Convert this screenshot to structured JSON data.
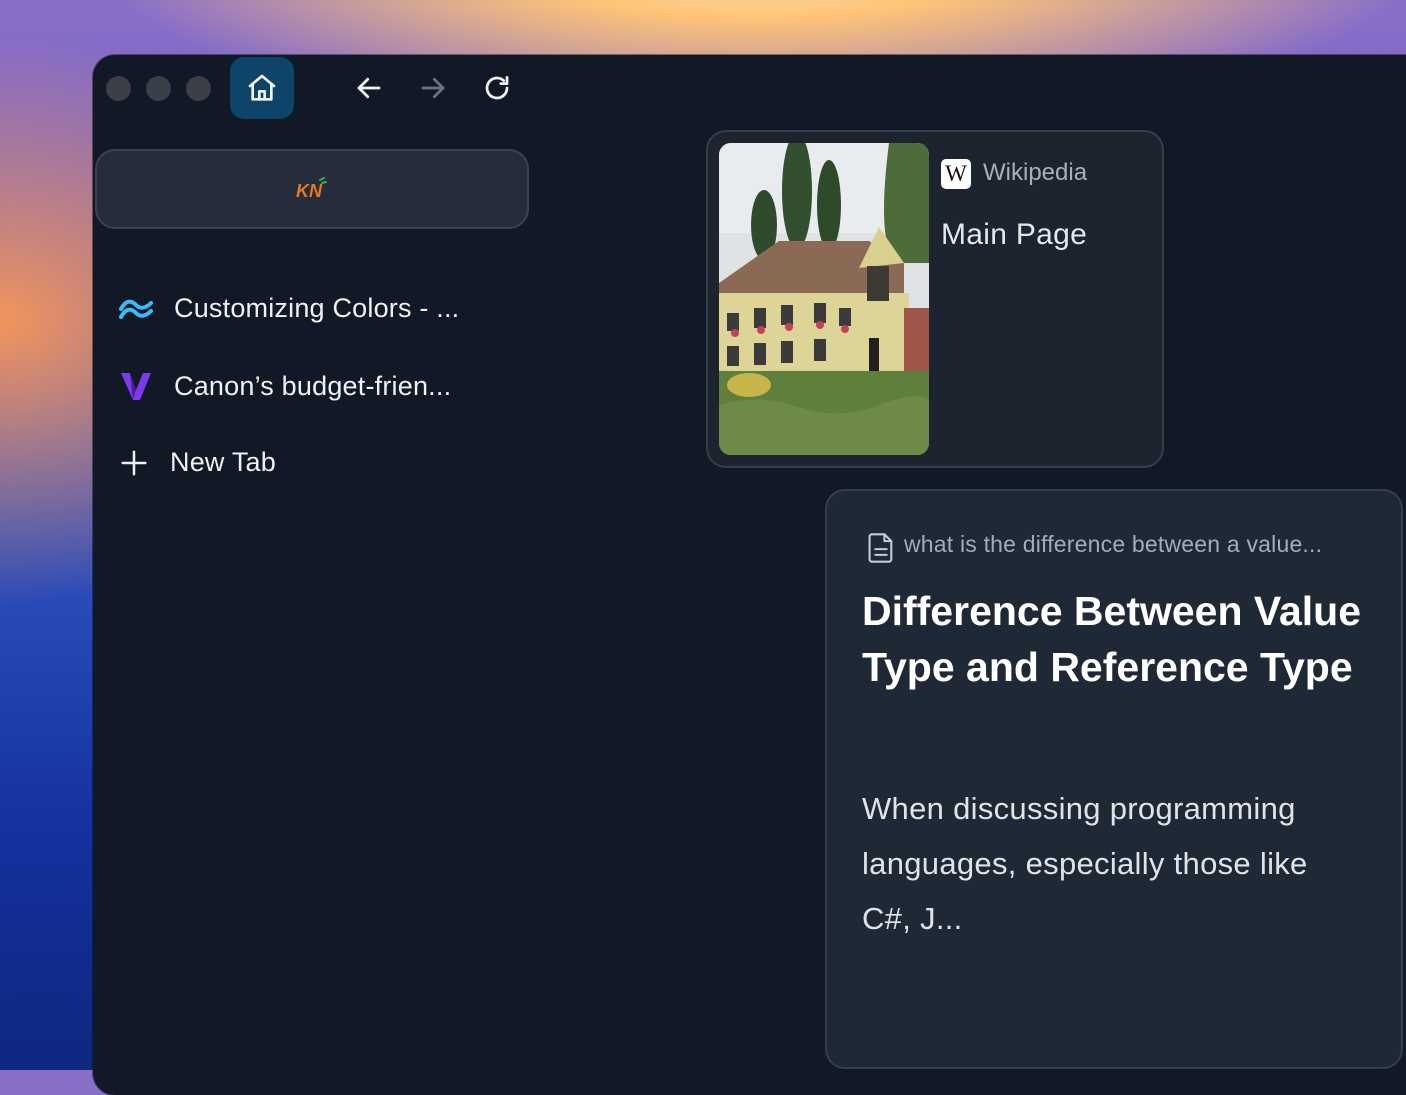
{
  "window": {
    "controls": [
      "close",
      "minimize",
      "zoom"
    ],
    "toolbar": {
      "home_icon": "home-icon",
      "back_icon": "arrow-left-icon",
      "forward_icon": "arrow-right-icon",
      "reload_icon": "reload-icon"
    }
  },
  "urlbar": {
    "logo_text": "KN"
  },
  "tabs": [
    {
      "icon": "tailwind-icon",
      "label": "Customizing Colors - ..."
    },
    {
      "icon": "v-logo-icon",
      "label": "Canon’s budget-frien..."
    }
  ],
  "new_tab": {
    "icon": "plus-icon",
    "label": "New Tab"
  },
  "wiki_card": {
    "source_logo": "W",
    "source": "Wikipedia",
    "title": "Main Page"
  },
  "article_card": {
    "query": "what is the difference between a value...",
    "title": "Difference Between Value Type and Reference Type",
    "snippet": "When discussing programming languages, especially those like  C#, J..."
  },
  "colors": {
    "window_bg": "#111826",
    "card_bg": "#1c2430",
    "home_button_bg": "#0e4468",
    "tailwind_accent": "#38bdf8",
    "v_logo_accent": "#7c3aed"
  }
}
